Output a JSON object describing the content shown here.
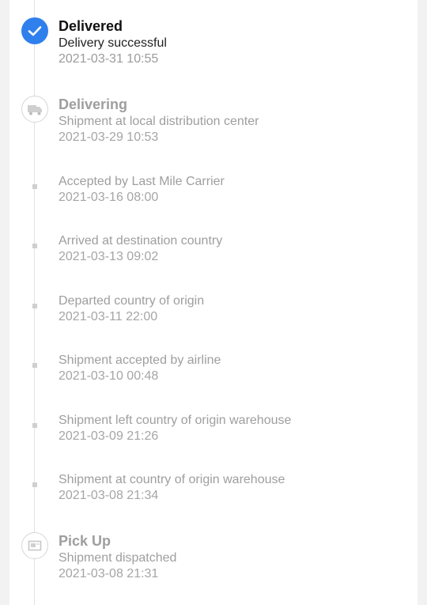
{
  "timeline": {
    "events": [
      {
        "title": "Delivered",
        "description": "Delivery successful",
        "time": "2021-03-31 10:55",
        "icon": "check-icon",
        "status": "active"
      },
      {
        "title": "Delivering",
        "description": "Shipment at local distribution center",
        "time": "2021-03-29 10:53",
        "icon": "truck-icon",
        "status": "past"
      },
      {
        "description": "Accepted by Last Mile Carrier",
        "time": "2021-03-16 08:00"
      },
      {
        "description": "Arrived at destination country",
        "time": "2021-03-13 09:02"
      },
      {
        "description": "Departed country of origin",
        "time": "2021-03-11 22:00"
      },
      {
        "description": "Shipment accepted by airline",
        "time": "2021-03-10 00:48"
      },
      {
        "description": "Shipment left country of origin warehouse",
        "time": "2021-03-09 21:26"
      },
      {
        "description": "Shipment at country of origin warehouse",
        "time": "2021-03-08 21:34"
      },
      {
        "title": "Pick Up",
        "description": "Shipment dispatched",
        "time": "2021-03-08 21:31",
        "icon": "package-icon",
        "status": "past"
      }
    ]
  },
  "colors": {
    "accent": "#2f80ed",
    "muted_text": "#9e9e9e",
    "primary_text": "#111111"
  }
}
